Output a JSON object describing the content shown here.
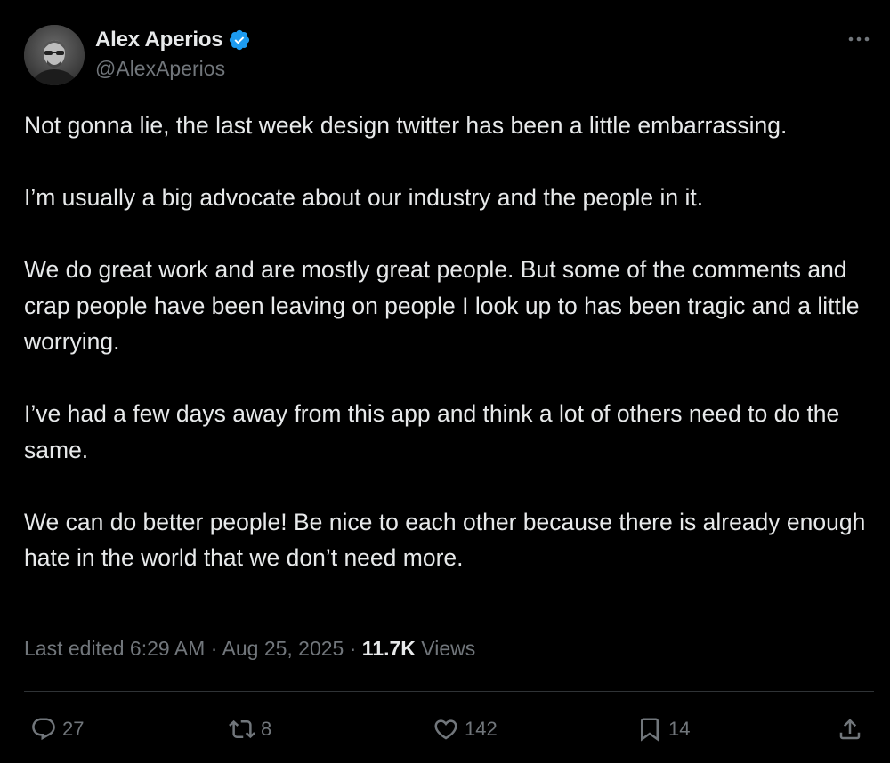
{
  "author": {
    "display_name": "Alex Aperios",
    "handle": "@AlexAperios",
    "verified": true
  },
  "icons": {
    "verified": "verified-badge-icon",
    "more": "more-options-icon",
    "reply": "reply-icon",
    "repost": "repost-icon",
    "like": "like-icon",
    "bookmark": "bookmark-icon",
    "share": "share-icon"
  },
  "colors": {
    "background": "#000000",
    "text": "#e7e9ea",
    "secondary": "#71767b",
    "verified": "#1d9bf0",
    "divider": "#2f3336"
  },
  "tweet": {
    "paragraphs": [
      "Not gonna lie, the last week design twitter has been a little embarrassing.",
      "I’m usually a big advocate about our industry and the people in it.",
      "We do great work and are mostly great people. But some of the comments and crap people have been leaving on people I look up to has been tragic and a little worrying.",
      "I’ve had a few days away from this app and think a lot of others need to do the same.",
      "We can do better people! Be nice to each other because there is already enough hate in the world that we don’t need more."
    ]
  },
  "meta": {
    "edited_label": "Last edited 6:29 AM",
    "separator": "·",
    "date": "Aug 25, 2025",
    "views_count": "11.7K",
    "views_label": "Views"
  },
  "actions": {
    "replies": "27",
    "reposts": "8",
    "likes": "142",
    "bookmarks": "14"
  }
}
